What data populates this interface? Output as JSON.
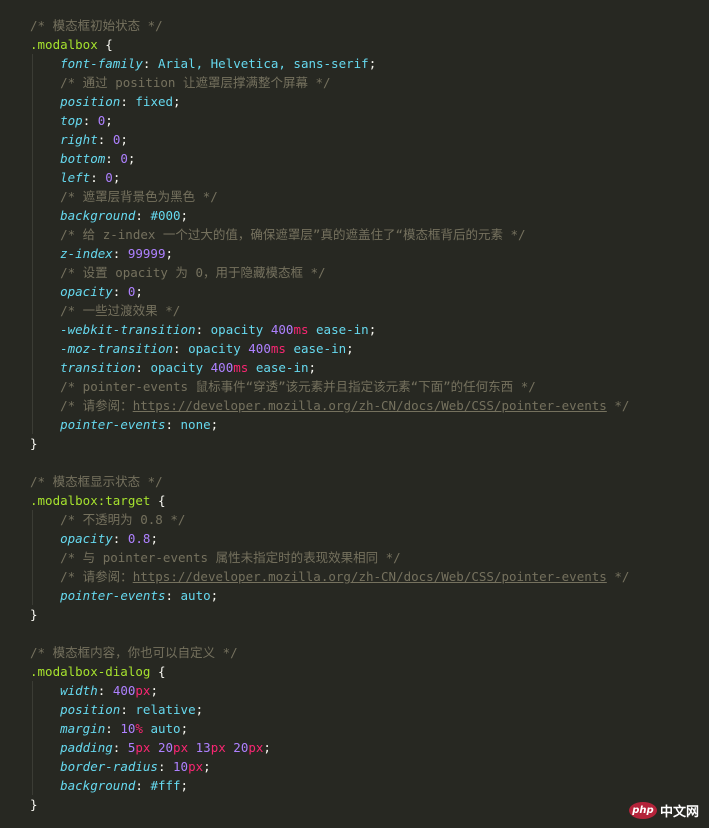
{
  "theme": {
    "background": "#272822",
    "comment": "#75715e",
    "selector": "#a6e22e",
    "property": "#66d9ef",
    "number": "#ae81ff",
    "unit": "#f92672",
    "text": "#f8f8f2"
  },
  "lines": [
    [
      [
        "c",
        "/* 模态框初始状态 */"
      ]
    ],
    [
      [
        "s",
        ".modalbox"
      ],
      [
        "k",
        " {"
      ]
    ],
    [
      [
        "k",
        "    "
      ],
      [
        "p",
        "font-family"
      ],
      [
        "k",
        ": "
      ],
      [
        "v",
        "Arial, Helvetica, sans-serif"
      ],
      [
        "k",
        ";"
      ]
    ],
    [
      [
        "k",
        "    "
      ],
      [
        "c",
        "/* 通过 position 让遮罩层撑满整个屏幕 */"
      ]
    ],
    [
      [
        "k",
        "    "
      ],
      [
        "p",
        "position"
      ],
      [
        "k",
        ": "
      ],
      [
        "v",
        "fixed"
      ],
      [
        "k",
        ";"
      ]
    ],
    [
      [
        "k",
        "    "
      ],
      [
        "p",
        "top"
      ],
      [
        "k",
        ": "
      ],
      [
        "n",
        "0"
      ],
      [
        "k",
        ";"
      ]
    ],
    [
      [
        "k",
        "    "
      ],
      [
        "p",
        "right"
      ],
      [
        "k",
        ": "
      ],
      [
        "n",
        "0"
      ],
      [
        "k",
        ";"
      ]
    ],
    [
      [
        "k",
        "    "
      ],
      [
        "p",
        "bottom"
      ],
      [
        "k",
        ": "
      ],
      [
        "n",
        "0"
      ],
      [
        "k",
        ";"
      ]
    ],
    [
      [
        "k",
        "    "
      ],
      [
        "p",
        "left"
      ],
      [
        "k",
        ": "
      ],
      [
        "n",
        "0"
      ],
      [
        "k",
        ";"
      ]
    ],
    [
      [
        "k",
        "    "
      ],
      [
        "c",
        "/* 遮罩层背景色为黑色 */"
      ]
    ],
    [
      [
        "k",
        "    "
      ],
      [
        "p",
        "background"
      ],
      [
        "k",
        ": "
      ],
      [
        "v",
        "#000"
      ],
      [
        "k",
        ";"
      ]
    ],
    [
      [
        "k",
        "    "
      ],
      [
        "c",
        "/* 给 z-index 一个过大的值，确保遮罩层”真的遮盖住了“模态框背后的元素 */"
      ]
    ],
    [
      [
        "k",
        "    "
      ],
      [
        "p",
        "z-index"
      ],
      [
        "k",
        ": "
      ],
      [
        "n",
        "99999"
      ],
      [
        "k",
        ";"
      ]
    ],
    [
      [
        "k",
        "    "
      ],
      [
        "c",
        "/* 设置 opacity 为 0，用于隐藏模态框 */"
      ]
    ],
    [
      [
        "k",
        "    "
      ],
      [
        "p",
        "opacity"
      ],
      [
        "k",
        ": "
      ],
      [
        "n",
        "0"
      ],
      [
        "k",
        ";"
      ]
    ],
    [
      [
        "k",
        "    "
      ],
      [
        "c",
        "/* 一些过渡效果 */"
      ]
    ],
    [
      [
        "k",
        "    "
      ],
      [
        "p",
        "-webkit-transition"
      ],
      [
        "k",
        ": "
      ],
      [
        "v",
        "opacity "
      ],
      [
        "n",
        "400"
      ],
      [
        "u",
        "ms"
      ],
      [
        "v",
        " ease-in"
      ],
      [
        "k",
        ";"
      ]
    ],
    [
      [
        "k",
        "    "
      ],
      [
        "p",
        "-moz-transition"
      ],
      [
        "k",
        ": "
      ],
      [
        "v",
        "opacity "
      ],
      [
        "n",
        "400"
      ],
      [
        "u",
        "ms"
      ],
      [
        "v",
        " ease-in"
      ],
      [
        "k",
        ";"
      ]
    ],
    [
      [
        "k",
        "    "
      ],
      [
        "p",
        "transition"
      ],
      [
        "k",
        ": "
      ],
      [
        "v",
        "opacity "
      ],
      [
        "n",
        "400"
      ],
      [
        "u",
        "ms"
      ],
      [
        "v",
        " ease-in"
      ],
      [
        "k",
        ";"
      ]
    ],
    [
      [
        "k",
        "    "
      ],
      [
        "c",
        "/* pointer-events 鼠标事件“穿透”该元素并且指定该元素“下面”的任何东西 */"
      ]
    ],
    [
      [
        "k",
        "    "
      ],
      [
        "c",
        "/* 请参阅："
      ],
      [
        "cl",
        "https://developer.mozilla.org/zh-CN/docs/Web/CSS/pointer-events"
      ],
      [
        "c",
        " */"
      ]
    ],
    [
      [
        "k",
        "    "
      ],
      [
        "p",
        "pointer-events"
      ],
      [
        "k",
        ": "
      ],
      [
        "v",
        "none"
      ],
      [
        "k",
        ";"
      ]
    ],
    [
      [
        "k",
        "}"
      ]
    ],
    [],
    [
      [
        "c",
        "/* 模态框显示状态 */"
      ]
    ],
    [
      [
        "s",
        ".modalbox:target"
      ],
      [
        "k",
        " {"
      ]
    ],
    [
      [
        "k",
        "    "
      ],
      [
        "c",
        "/* 不透明为 0.8 */"
      ]
    ],
    [
      [
        "k",
        "    "
      ],
      [
        "p",
        "opacity"
      ],
      [
        "k",
        ": "
      ],
      [
        "n",
        "0.8"
      ],
      [
        "k",
        ";"
      ]
    ],
    [
      [
        "k",
        "    "
      ],
      [
        "c",
        "/* 与 pointer-events 属性未指定时的表现效果相同 */"
      ]
    ],
    [
      [
        "k",
        "    "
      ],
      [
        "c",
        "/* 请参阅："
      ],
      [
        "cl",
        "https://developer.mozilla.org/zh-CN/docs/Web/CSS/pointer-events"
      ],
      [
        "c",
        " */"
      ]
    ],
    [
      [
        "k",
        "    "
      ],
      [
        "p",
        "pointer-events"
      ],
      [
        "k",
        ": "
      ],
      [
        "v",
        "auto"
      ],
      [
        "k",
        ";"
      ]
    ],
    [
      [
        "k",
        "}"
      ]
    ],
    [],
    [
      [
        "c",
        "/* 模态框内容，你也可以自定义 */"
      ]
    ],
    [
      [
        "s",
        ".modalbox-dialog"
      ],
      [
        "k",
        " {"
      ]
    ],
    [
      [
        "k",
        "    "
      ],
      [
        "p",
        "width"
      ],
      [
        "k",
        ": "
      ],
      [
        "n",
        "400"
      ],
      [
        "u",
        "px"
      ],
      [
        "k",
        ";"
      ]
    ],
    [
      [
        "k",
        "    "
      ],
      [
        "p",
        "position"
      ],
      [
        "k",
        ": "
      ],
      [
        "v",
        "relative"
      ],
      [
        "k",
        ";"
      ]
    ],
    [
      [
        "k",
        "    "
      ],
      [
        "p",
        "margin"
      ],
      [
        "k",
        ": "
      ],
      [
        "n",
        "10"
      ],
      [
        "u",
        "%"
      ],
      [
        "v",
        " auto"
      ],
      [
        "k",
        ";"
      ]
    ],
    [
      [
        "k",
        "    "
      ],
      [
        "p",
        "padding"
      ],
      [
        "k",
        ": "
      ],
      [
        "n",
        "5"
      ],
      [
        "u",
        "px"
      ],
      [
        "k",
        " "
      ],
      [
        "n",
        "20"
      ],
      [
        "u",
        "px"
      ],
      [
        "k",
        " "
      ],
      [
        "n",
        "13"
      ],
      [
        "u",
        "px"
      ],
      [
        "k",
        " "
      ],
      [
        "n",
        "20"
      ],
      [
        "u",
        "px"
      ],
      [
        "k",
        ";"
      ]
    ],
    [
      [
        "k",
        "    "
      ],
      [
        "p",
        "border-radius"
      ],
      [
        "k",
        ": "
      ],
      [
        "n",
        "10"
      ],
      [
        "u",
        "px"
      ],
      [
        "k",
        ";"
      ]
    ],
    [
      [
        "k",
        "    "
      ],
      [
        "p",
        "background"
      ],
      [
        "k",
        ": "
      ],
      [
        "v",
        "#fff"
      ],
      [
        "k",
        ";"
      ]
    ],
    [
      [
        "k",
        "}"
      ]
    ]
  ],
  "watermark": {
    "badge": "php",
    "text": "中文网"
  }
}
